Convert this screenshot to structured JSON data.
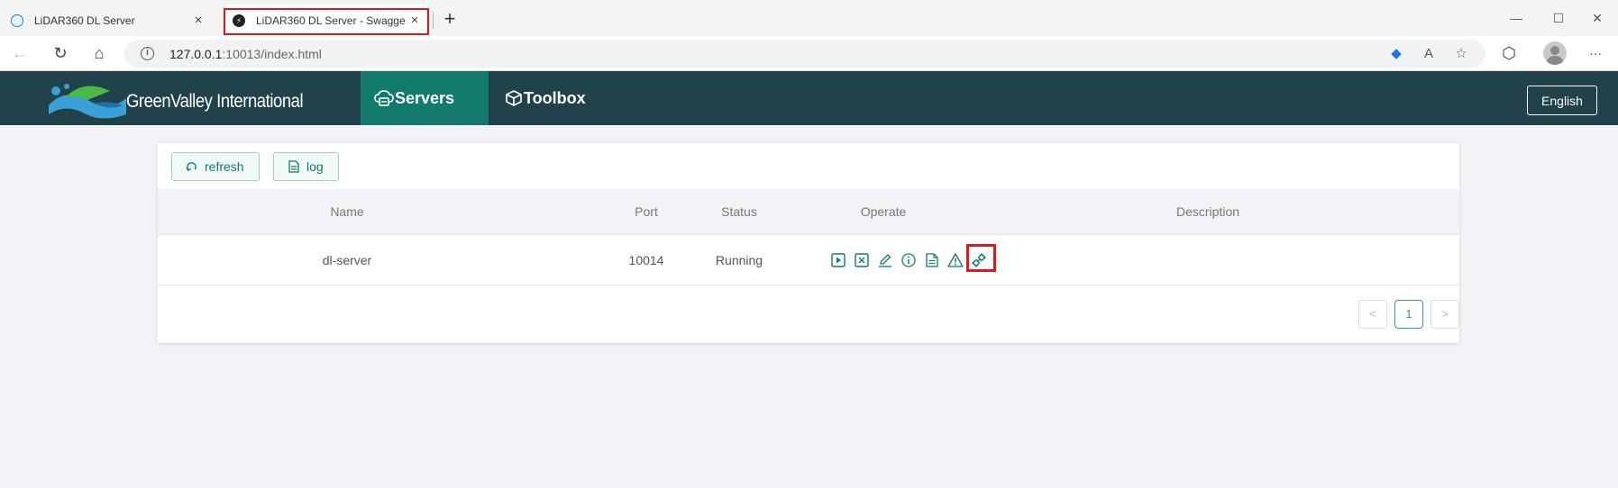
{
  "browser": {
    "tabs": [
      {
        "title": "LiDAR360 DL Server",
        "close": "×"
      },
      {
        "title": "LiDAR360 DL Server - Swagger UI",
        "close": "×"
      }
    ],
    "new_tab": "+",
    "window_controls": {
      "minimize": "—",
      "maximize": "☐",
      "close": "✕"
    },
    "url_host": "127.0.0.1",
    "url_path": ":10013/index.html",
    "more_menu": "···"
  },
  "app": {
    "logo_text": "GreenValley International",
    "nav": {
      "servers": "Servers",
      "toolbox": "Toolbox"
    },
    "language": "English",
    "accent_color": "#117a6a",
    "header_color": "#21424a"
  },
  "toolbar": {
    "refresh_label": "refresh",
    "log_label": "log"
  },
  "table": {
    "headers": {
      "name": "Name",
      "port": "Port",
      "status": "Status",
      "operate": "Operate",
      "description": "Description"
    },
    "rows": [
      {
        "name": "dl-server",
        "port": "10014",
        "status": "Running",
        "description": "",
        "operations": [
          "play-icon",
          "stop-icon",
          "edit-icon",
          "info-icon",
          "document-icon",
          "warning-icon",
          "link-icon"
        ]
      }
    ]
  },
  "pagination": {
    "prev": "<",
    "current_page": "1",
    "next": ">"
  }
}
